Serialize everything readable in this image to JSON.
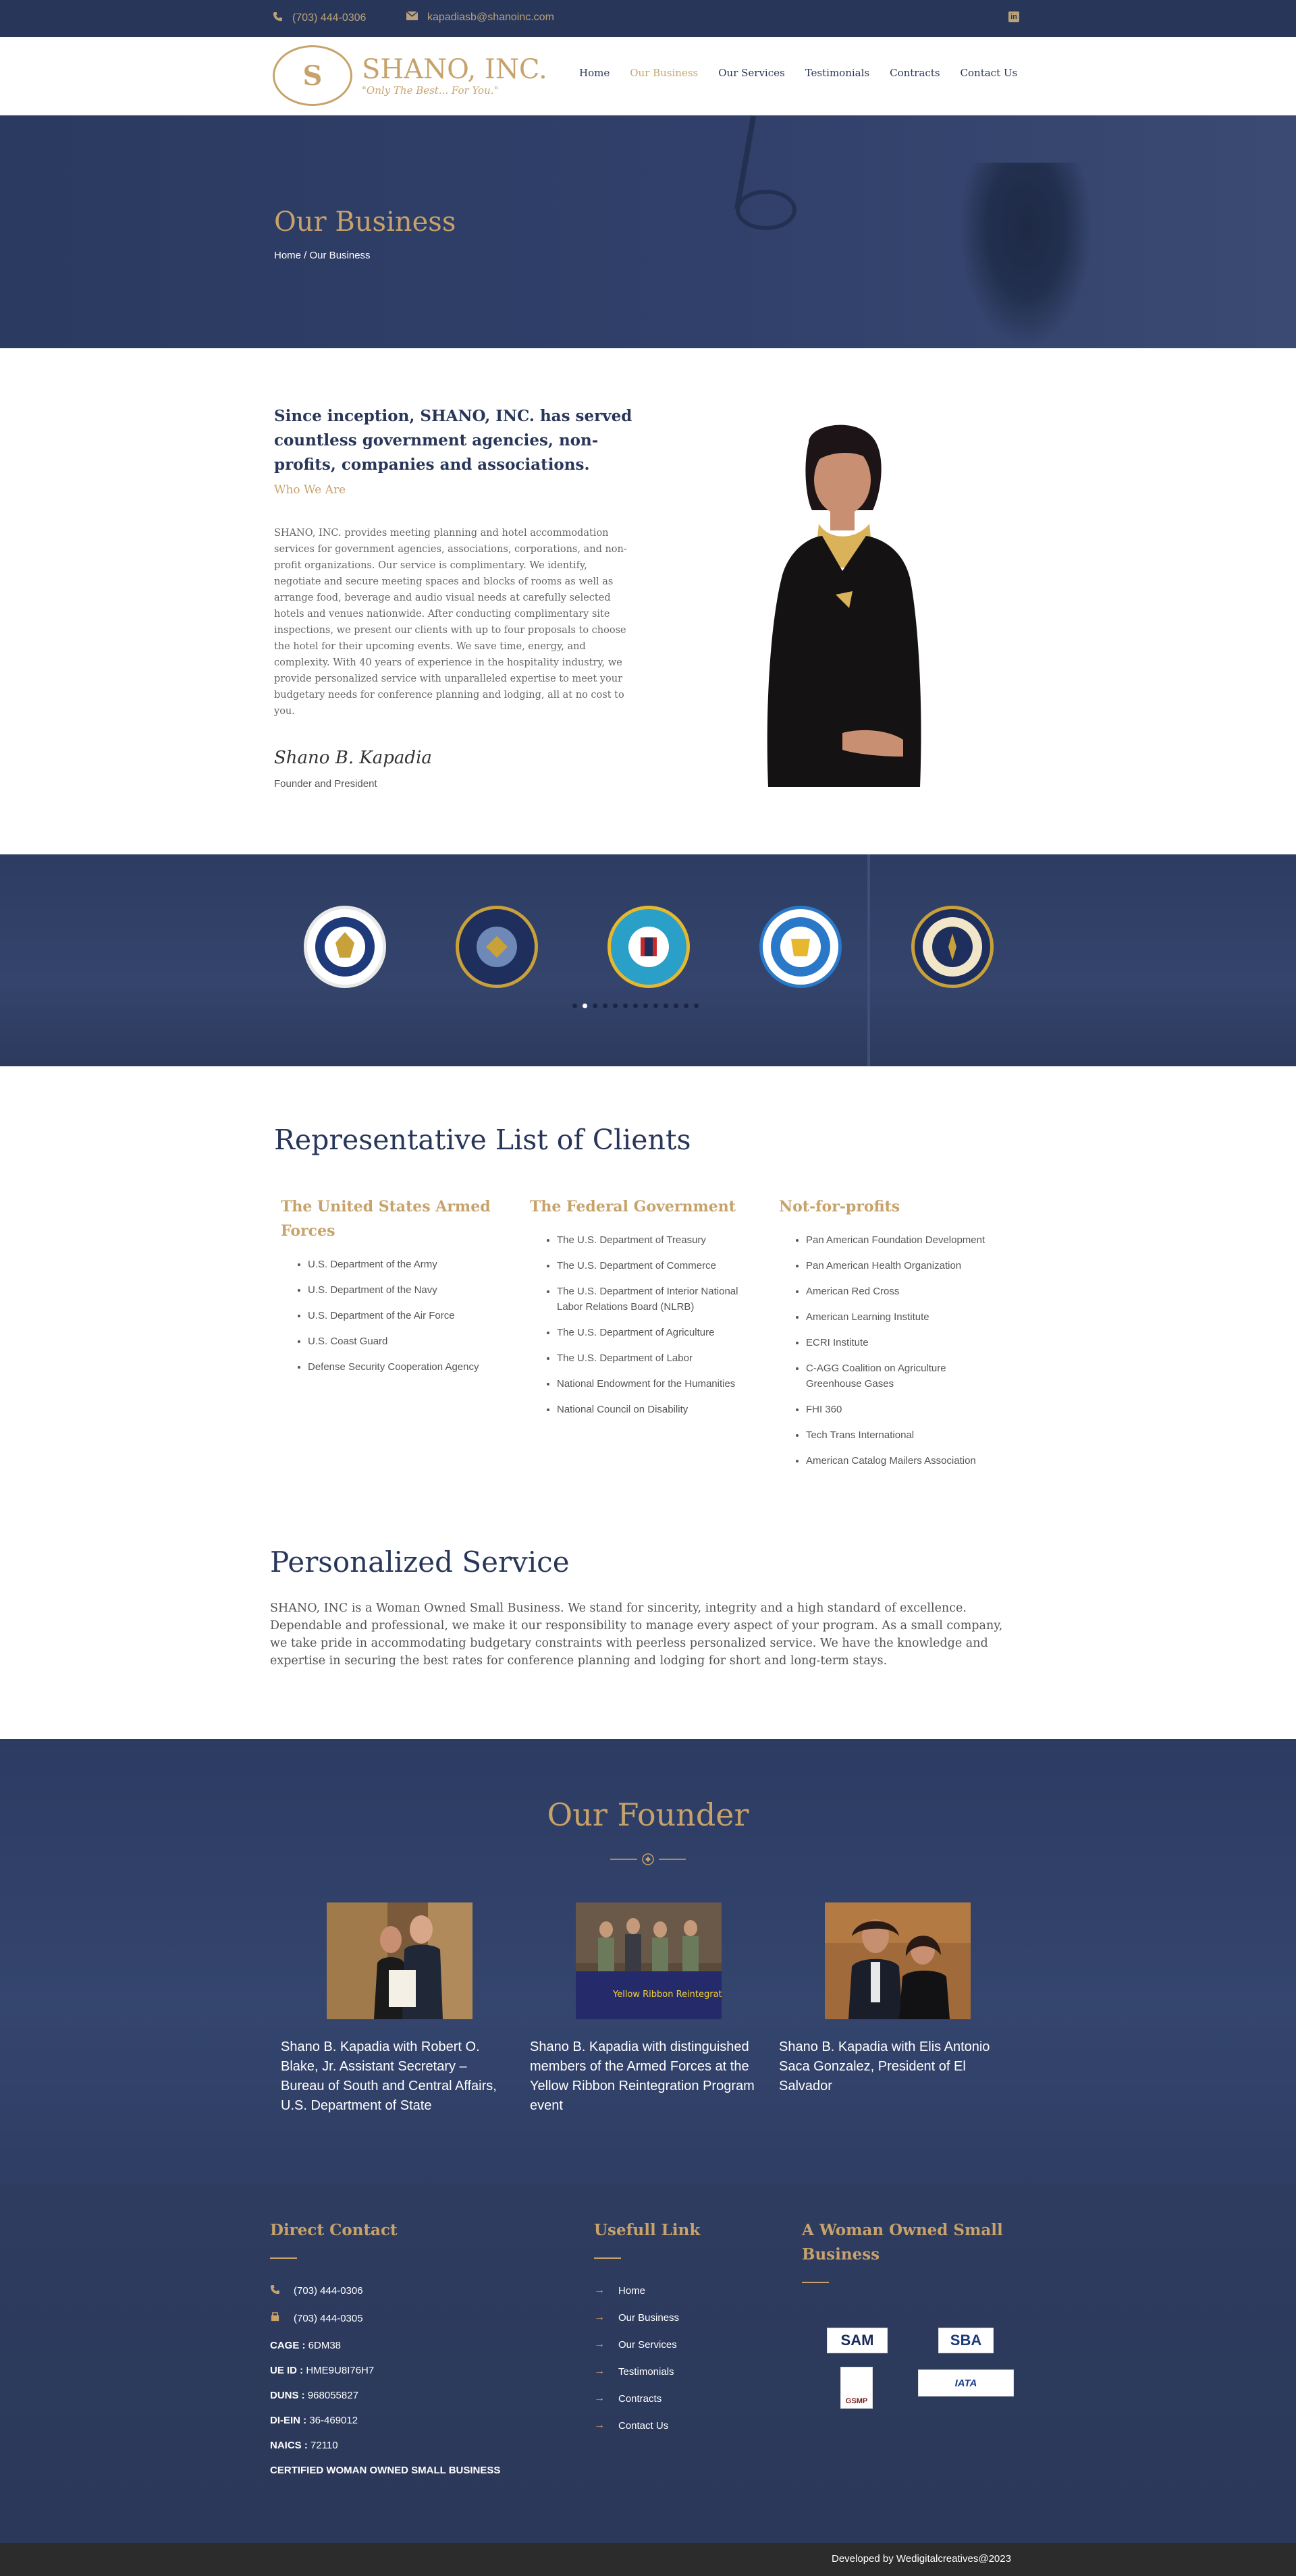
{
  "topbar": {
    "phone": "(703) 444-0306",
    "email": "kapadiasb@shanoinc.com",
    "linkedin": "in"
  },
  "logo": {
    "monogram": "S",
    "name": "SHANO, INC.",
    "tagline": "\"Only The Best... For You.\""
  },
  "nav": [
    "Home",
    "Our Business",
    "Our Services",
    "Testimonials",
    "Contracts",
    "Contact Us"
  ],
  "hero": {
    "title": "Our Business",
    "breadcrumb": "Home / Our Business"
  },
  "about": {
    "heading": "Since inception, SHANO, INC. has served countless government agencies, non-profits, companies and associations.",
    "subheading": "Who We Are",
    "paragraph": "SHANO, INC. provides meeting planning and hotel accommodation services for government agencies, associations, corporations, and non-profit organizations. Our service is complimentary. We identify, negotiate and secure meeting spaces and blocks of rooms as well as arrange food, beverage and audio visual needs at carefully selected hotels and venues nationwide. After conducting complimentary site inspections, we present our clients with up to four proposals to choose the hotel for their upcoming events. We save time, energy, and complexity. With 40 years of experience in the hospitality industry, we provide personalized service with unparalleled expertise to meet your budgetary needs for conference planning and lodging, all at no cost to you.",
    "signature": "Shano B. Kapadia",
    "role": "Founder and President"
  },
  "seals": [
    {
      "name": "department-of-labor-seal",
      "ring": "#e8e8e8",
      "inner": "#1f3a7a"
    },
    {
      "name": "dod-seal",
      "ring": "#c9a13a",
      "inner": "#1e2f5e"
    },
    {
      "name": "coast-guard-seal",
      "ring": "#e6b82e",
      "inner": "#2aa0c8"
    },
    {
      "name": "department-of-commerce-seal",
      "ring": "#2a79c9",
      "inner": "#ffffff"
    },
    {
      "name": "department-of-navy-seal",
      "ring": "#c9a13a",
      "inner": "#1e2f5e"
    }
  ],
  "clients": {
    "title": "Representative List of Clients",
    "columns": [
      {
        "heading": "The United States Armed Forces",
        "items": [
          "U.S. Department of the Army",
          "U.S. Department of the Navy",
          "U.S. Department of the Air Force",
          "U.S. Coast Guard",
          "Defense Security Cooperation Agency"
        ]
      },
      {
        "heading": "The Federal Government",
        "items": [
          "The U.S. Department of Treasury",
          "The U.S. Department of Commerce",
          "The U.S. Department of Interior National Labor Relations Board (NLRB)",
          "The U.S. Department of Agriculture",
          "The U.S. Department of Labor",
          "National Endowment for the Humanities",
          "National Council on Disability"
        ]
      },
      {
        "heading": "Not-for-profits",
        "items": [
          "Pan American Foundation Development",
          "Pan American Health Organization",
          "American Red Cross",
          "American Learning Institute",
          "ECRI Institute",
          "C-AGG Coalition on Agriculture Greenhouse Gases",
          "FHI 360",
          "Tech Trans International",
          "American Catalog Mailers Association"
        ]
      }
    ]
  },
  "personal": {
    "title": "Personalized Service",
    "text": "SHANO, INC is a Woman Owned Small Business. We stand for sincerity, integrity and a high standard of excellence. Dependable and professional, we make it our responsibility to manage every aspect of your program. As a small company, we take pride in accommodating budgetary constraints with peerless personalized service. We have the knowledge and expertise in securing the best rates for conference planning and lodging for short and long-term stays."
  },
  "founder": {
    "title": "Our Founder",
    "cards": [
      {
        "caption": "Shano B. Kapadia with Robert O. Blake, Jr. Assistant Secretary – Bureau of South and Central Affairs, U.S. Department of State"
      },
      {
        "caption": "Shano B. Kapadia with distinguished members of the Armed Forces at the Yellow Ribbon Reintegration Program event",
        "banner": "Yellow Ribbon Reintegration Program"
      },
      {
        "caption": "Shano B. Kapadia with Elis Antonio Saca Gonzalez, President of El Salvador"
      }
    ]
  },
  "footer": {
    "contact_title": "Direct Contact",
    "phone": "(703) 444-0306",
    "fax": "(703) 444-0305",
    "ids": [
      {
        "k": "CAGE :",
        "v": "6DM38"
      },
      {
        "k": "UE ID :",
        "v": "HME9U8I76H7"
      },
      {
        "k": "DUNS :",
        "v": "968055827"
      },
      {
        "k": "DI-EIN :",
        "v": "36-469012"
      },
      {
        "k": "NAICS :",
        "v": "72110"
      }
    ],
    "certified": "CERTIFIED WOMAN OWNED SMALL BUSINESS",
    "links_title": "Usefull Link",
    "links": [
      "Home",
      "Our Business",
      "Our Services",
      "Testimonials",
      "Contracts",
      "Contact Us"
    ],
    "wosb_title": "A Woman Owned Small Business",
    "badges": {
      "sam": "SAM",
      "sba": "SBA",
      "gsmp": "GSMP",
      "iata": "IATA"
    },
    "credit": "Developed by Wedigitalcreatives@2023"
  }
}
